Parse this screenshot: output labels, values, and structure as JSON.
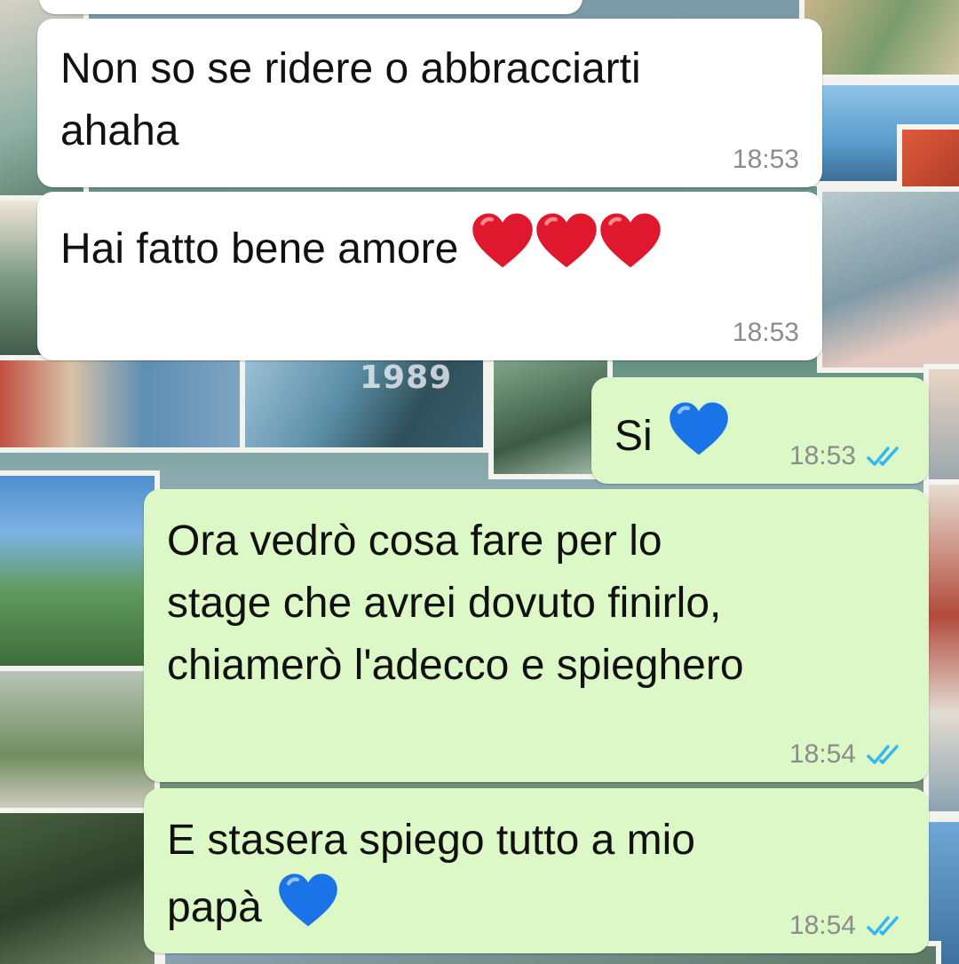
{
  "messages": [
    {
      "direction": "incoming",
      "text": "Non so se ridere o abbracciarti\nahaha",
      "time": "18:53"
    },
    {
      "direction": "incoming",
      "text": "Hai fatto bene amore",
      "emoji": [
        "red-heart",
        "red-heart",
        "red-heart"
      ],
      "time": "18:53"
    },
    {
      "direction": "outgoing",
      "text": "Si",
      "emoji": [
        "blue-heart"
      ],
      "time": "18:53",
      "status": "read"
    },
    {
      "direction": "outgoing",
      "text": "Ora vedrò cosa fare per lo\nstage che avrei dovuto finirlo,\nchiamerò l'adecco e spieghero",
      "time": "18:54",
      "status": "read"
    },
    {
      "direction": "outgoing",
      "text": "E stasera spiego tutto a mio\npapà",
      "emoji": [
        "blue-heart"
      ],
      "time": "18:54",
      "status": "read"
    }
  ],
  "wallpaper_text": "1989",
  "colors": {
    "incoming_bubble": "#ffffff",
    "outgoing_bubble": "#dcf8c6",
    "timestamp": "#8c8c8c",
    "read_ticks": "#34b7f1",
    "red_heart": "#e0182d",
    "blue_heart": "#1b73e8"
  }
}
